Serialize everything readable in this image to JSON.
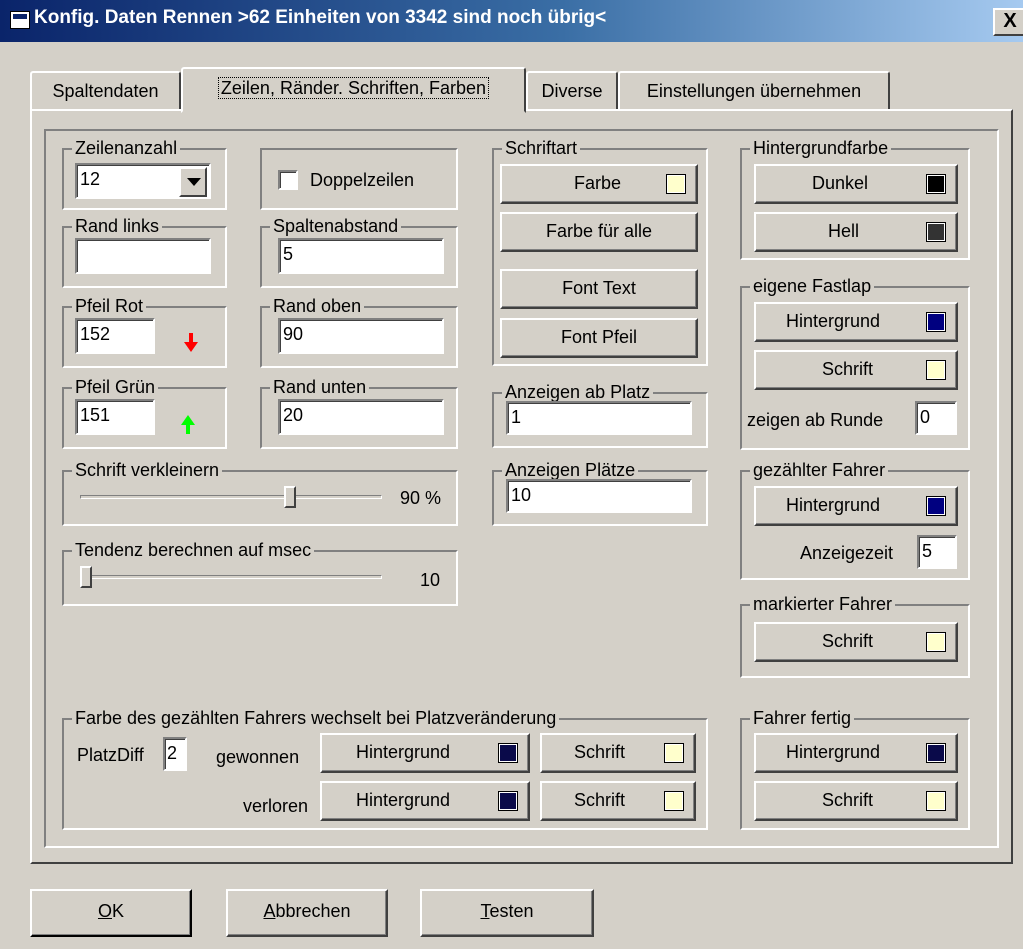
{
  "window": {
    "title": "Konfig. Daten Rennen >62 Einheiten von 3342 sind noch übrig<",
    "close_label": "X"
  },
  "tabs": [
    "Spaltendaten",
    "Zeilen, Ränder. Schriften, Farben",
    "Diverse",
    "Einstellungen übernehmen"
  ],
  "colors": {
    "dunkel": "#000000",
    "hell": "#333333",
    "navy": "#000080",
    "darknavy": "#0a0a4a",
    "cream": "#ffffcc",
    "red_arrow": "#ff0000",
    "green_arrow": "#00ff00"
  },
  "zeilenanzahl": {
    "label": "Zeilenanzahl",
    "value": "12"
  },
  "doppelzeilen": {
    "label": "Doppelzeilen",
    "checked": false
  },
  "rand_links": {
    "label": "Rand links",
    "value": ""
  },
  "spaltenabstand": {
    "label": "Spaltenabstand",
    "value": "5"
  },
  "pfeil_rot": {
    "label": "Pfeil Rot",
    "value": "152",
    "icon": "red-down-arrow-icon"
  },
  "rand_oben": {
    "label": "Rand oben",
    "value": "90"
  },
  "pfeil_gruen": {
    "label": "Pfeil Grün",
    "value": "151",
    "icon": "green-up-arrow-icon"
  },
  "rand_unten": {
    "label": "Rand unten",
    "value": "20"
  },
  "schrift_verkleinern": {
    "label": "Schrift verkleinern",
    "value_text": "90 %",
    "level": 0.9
  },
  "tendenz": {
    "label": "Tendenz berechnen auf msec",
    "value_text": "10",
    "level": 0.0
  },
  "schriftart": {
    "label": "Schriftart",
    "farbe": "Farbe",
    "farbe_alle": "Farbe für alle",
    "font_text": "Font Text",
    "font_pfeil": "Font Pfeil"
  },
  "anzeigen_ab_platz": {
    "label": "Anzeigen ab Platz",
    "value": "1"
  },
  "anzeigen_plaetze": {
    "label": "Anzeigen Plätze",
    "value": "10"
  },
  "hintergrundfarbe": {
    "label": "Hintergrundfarbe",
    "dunkel": "Dunkel",
    "hell": "Hell"
  },
  "eigene_fastlap": {
    "label": "eigene Fastlap",
    "hintergrund": "Hintergrund",
    "schrift": "Schrift",
    "zeigen_ab_runde_label": "zeigen ab Runde",
    "zeigen_ab_runde_value": "0"
  },
  "gezaehlter_fahrer": {
    "label": "gezählter Fahrer",
    "hintergrund": "Hintergrund",
    "anzeigezeit_label": "Anzeigezeit",
    "anzeigezeit_value": "5"
  },
  "markierter_fahrer": {
    "label": "markierter Fahrer",
    "schrift": "Schrift"
  },
  "farbwechsel": {
    "label": "Farbe des gezählten Fahrers wechselt bei Platzveränderung",
    "platzdiff_label": "PlatzDiff",
    "platzdiff_value": "2",
    "gewonnen": "gewonnen",
    "verloren": "verloren",
    "hintergrund": "Hintergrund",
    "schrift": "Schrift"
  },
  "fahrer_fertig": {
    "label": "Fahrer fertig",
    "hintergrund": "Hintergrund",
    "schrift": "Schrift"
  },
  "footer": {
    "ok_underline": "O",
    "ok_rest": "K",
    "abbrechen_underline": "A",
    "abbrechen_rest": "bbrechen",
    "testen_underline": "T",
    "testen_rest": "esten"
  }
}
